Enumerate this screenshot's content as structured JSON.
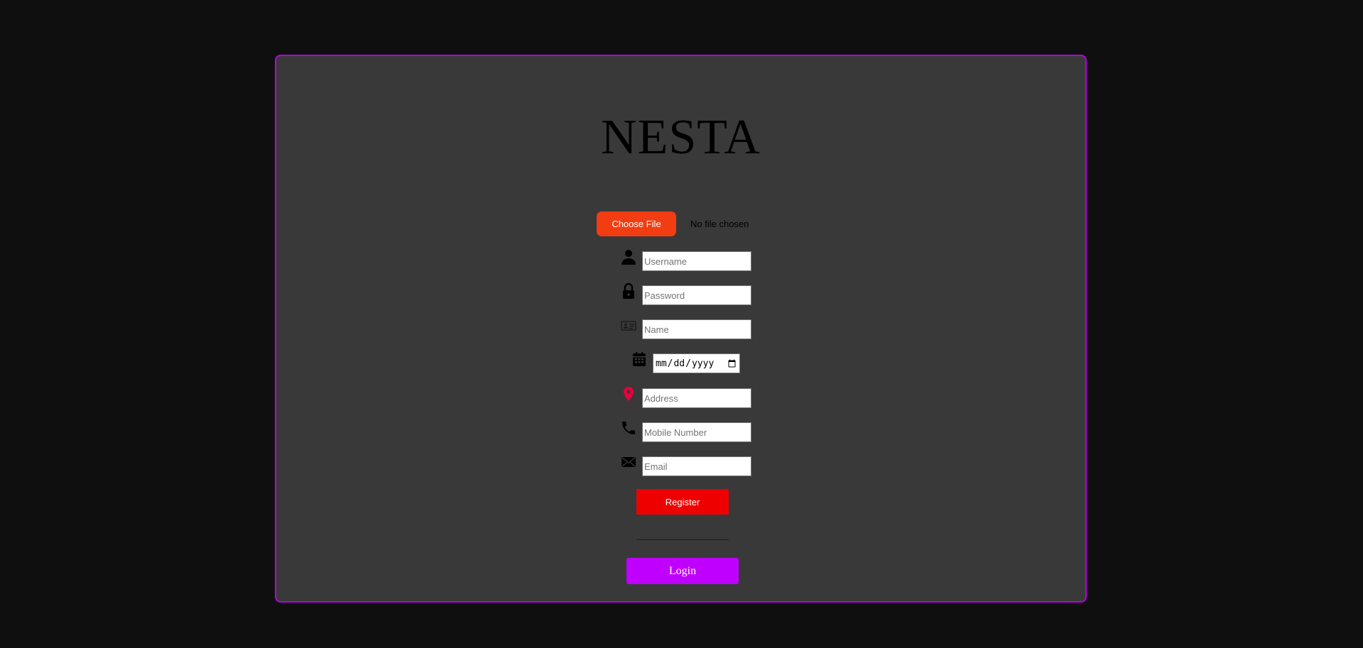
{
  "app": {
    "title": "NESTA"
  },
  "file_upload": {
    "button_label": "Choose File",
    "status": "No file chosen"
  },
  "form": {
    "username": {
      "placeholder": "Username",
      "icon": "user-icon"
    },
    "password": {
      "placeholder": "Password",
      "icon": "lock-icon"
    },
    "name": {
      "placeholder": "Name",
      "icon": "id-card-icon"
    },
    "date_of_birth": {
      "placeholder": "mm/dd/yyyy",
      "icon": "calendar-icon"
    },
    "address": {
      "placeholder": "Address",
      "icon": "map-pin-icon"
    },
    "mobile": {
      "placeholder": "Mobile Number",
      "icon": "phone-icon"
    },
    "email": {
      "placeholder": "Email",
      "icon": "envelope-icon"
    }
  },
  "actions": {
    "register_label": "Register",
    "login_label": "Login"
  },
  "colors": {
    "page_background": "#0f0f0f",
    "card_background": "#393939",
    "card_border": "#b800e6",
    "choose_file": "#f23d12",
    "register": "#ee0000",
    "login": "#c000ff",
    "pin_icon": "#e8003c"
  }
}
